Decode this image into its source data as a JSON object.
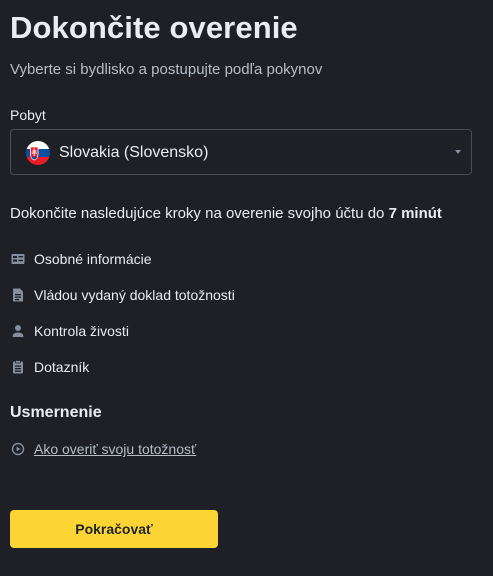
{
  "header": {
    "title": "Dokončite overenie",
    "subtitle": "Vyberte si bydlisko a postupujte podľa pokynov"
  },
  "residence": {
    "label": "Pobyt",
    "selected_value": "Slovakia (Slovensko)",
    "flag_icon": "slovakia-flag-icon"
  },
  "steps": {
    "intro_text": "Dokončite nasledujúce kroky na overenie svojho účtu do ",
    "intro_time": "7 minút",
    "items": [
      {
        "label": "Osobné informácie",
        "icon": "id-card-icon"
      },
      {
        "label": "Vládou vydaný doklad totožnosti",
        "icon": "document-icon"
      },
      {
        "label": "Kontrola živosti",
        "icon": "person-icon"
      },
      {
        "label": "Dotazník",
        "icon": "clipboard-icon"
      }
    ]
  },
  "guidance": {
    "title": "Usmernenie",
    "link_label": "Ako overiť svoju totožnosť",
    "link_icon": "play-circle-icon"
  },
  "actions": {
    "continue_label": "Pokračovať"
  },
  "colors": {
    "background": "#1e2026",
    "accent": "#fcd535",
    "border": "#474d57",
    "muted_text": "#b7bdc6",
    "icon": "#848e9c"
  }
}
